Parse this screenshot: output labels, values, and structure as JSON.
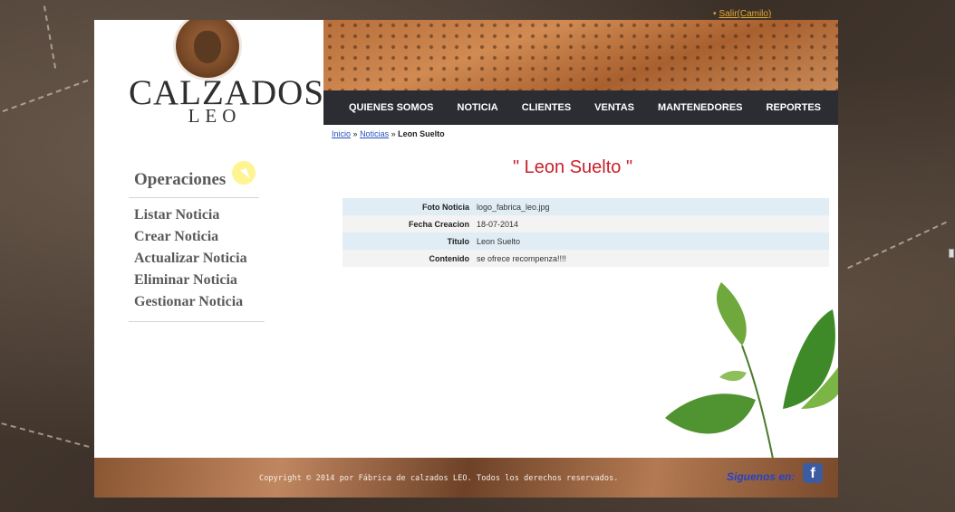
{
  "header": {
    "logout_label": "Salir(Camilo)",
    "brand_name": "CALZADOS",
    "brand_sub": "LEO"
  },
  "nav": {
    "items": [
      "QUIENES SOMOS",
      "NOTICIA",
      "CLIENTES",
      "VENTAS",
      "MANTENEDORES",
      "REPORTES"
    ]
  },
  "breadcrumb": {
    "home": "Inicio",
    "section": "Noticias",
    "current": "Leon Suelto",
    "separator": "»"
  },
  "page_title": "\" Leon Suelto \"",
  "sidebar": {
    "heading": "Operaciones",
    "items": [
      "Listar Noticia",
      "Crear Noticia",
      "Actualizar Noticia",
      "Eliminar Noticia",
      "Gestionar Noticia"
    ]
  },
  "detail": {
    "rows": [
      {
        "label": "Foto Noticia",
        "value": "logo_fabrica_leo.jpg"
      },
      {
        "label": "Fecha Creacion",
        "value": "18-07-2014"
      },
      {
        "label": "Titulo",
        "value": "Leon Suelto"
      },
      {
        "label": "Contenido",
        "value": "se ofrece recompenza!!!!"
      }
    ]
  },
  "footer": {
    "copyright": "Copyright © 2014 por Fábrica de calzados LEO. Todos los derechos reservados.",
    "follow": "Siguenos en:",
    "facebook_glyph": "f"
  },
  "colors": {
    "nav_bg": "#2b2d33",
    "title_red": "#c8202a",
    "link_blue": "#2a52be",
    "row_blue": "#e1edf4",
    "row_gray": "#f3f3f3"
  }
}
